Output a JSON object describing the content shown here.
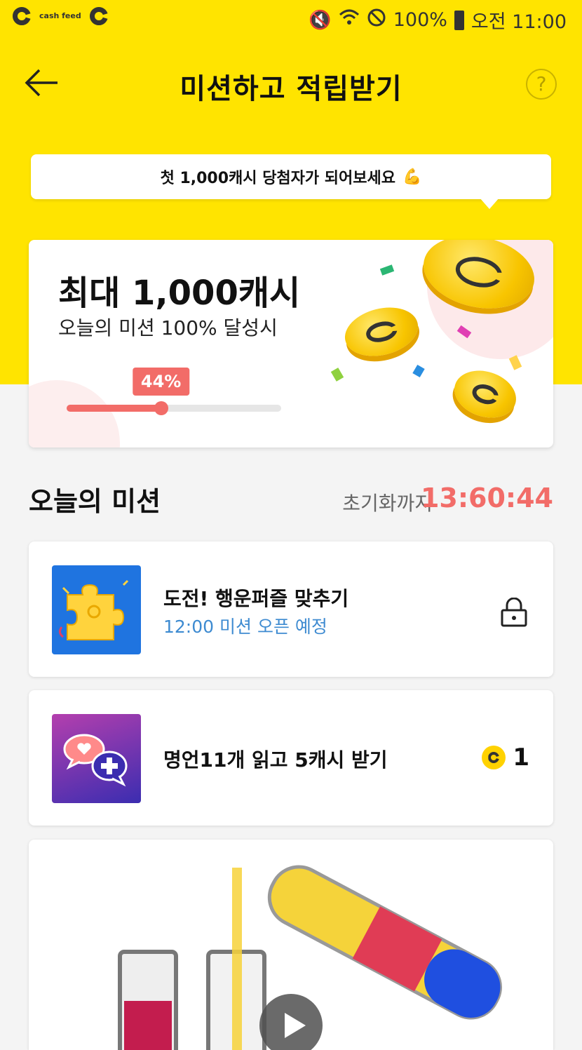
{
  "status_bar": {
    "brand_text": "cash feed",
    "battery": "100%",
    "time": "오전 11:00"
  },
  "header": {
    "title": "미션하고 적립받기",
    "help_label": "?"
  },
  "tooltip": {
    "text": "첫 1,000캐시 당첨자가 되어보세요",
    "emoji": "💪"
  },
  "reward_card": {
    "title": "최대 1,000캐시",
    "subtitle": "오늘의 미션 100% 달성시",
    "progress_label": "44%",
    "progress": 0.44
  },
  "missions_section": {
    "title": "오늘의 미션",
    "timer_label": "초기화까지",
    "timer_value": "13:60:44"
  },
  "missions": [
    {
      "title": "도전! 행운퍼즐 맞추기",
      "status": "12:00 미션 오픈 예정",
      "locked": true
    },
    {
      "title": "명언11개 읽고 5캐시 받기",
      "reward": "1",
      "locked": false
    }
  ],
  "colors": {
    "brand_yellow": "#ffe400",
    "accent_red": "#f26c68",
    "status_blue": "#3e8bd1"
  }
}
